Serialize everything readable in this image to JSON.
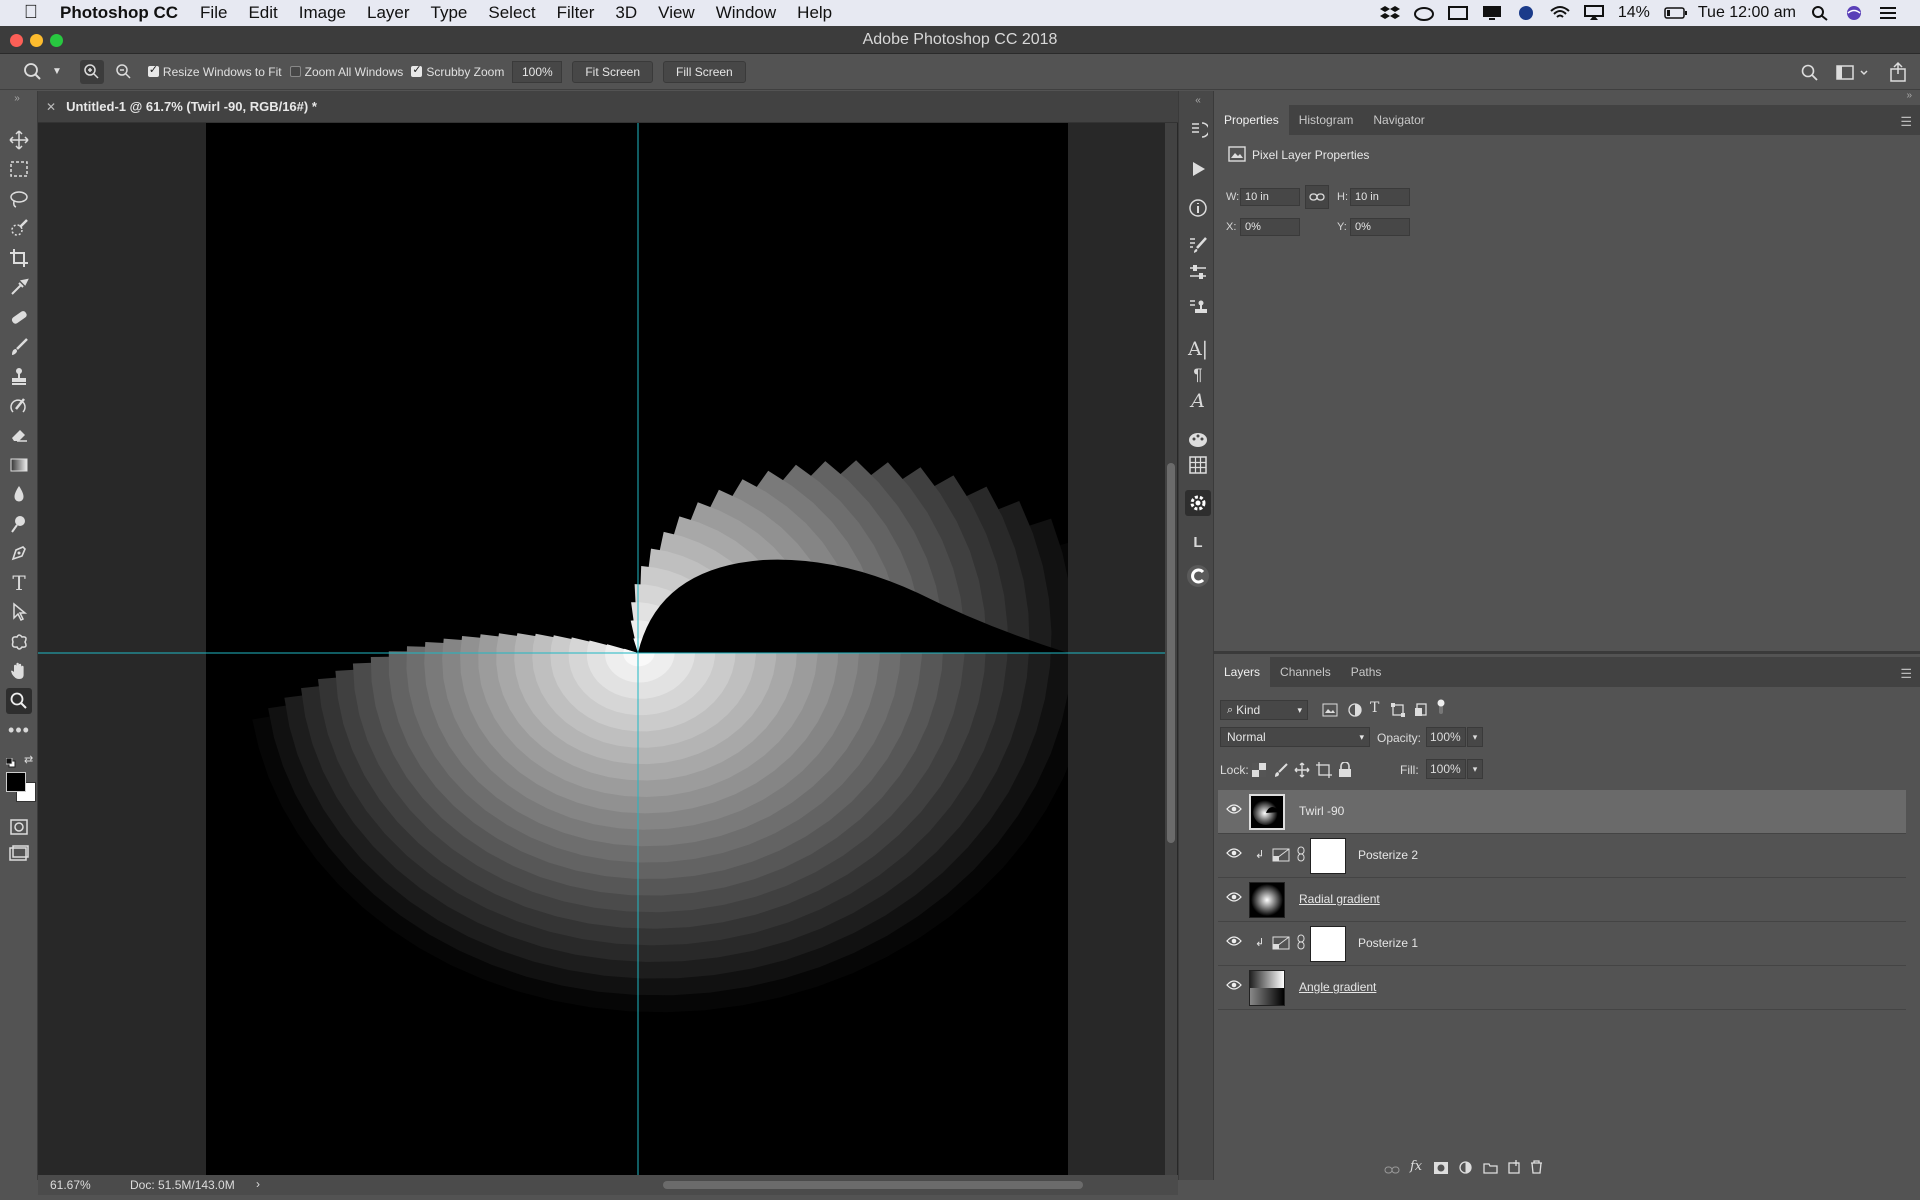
{
  "menubar": {
    "app_name": "Photoshop CC",
    "items": [
      "File",
      "Edit",
      "Image",
      "Layer",
      "Type",
      "Select",
      "Filter",
      "3D",
      "View",
      "Window",
      "Help"
    ],
    "battery": "14%",
    "clock": "Tue 12:00 am"
  },
  "window": {
    "title": "Adobe Photoshop CC 2018"
  },
  "options": {
    "resize_windows": "Resize Windows to Fit",
    "zoom_all": "Zoom All Windows",
    "scrubby_zoom": "Scrubby Zoom",
    "zoom_value": "100%",
    "fit_screen": "Fit Screen",
    "fill_screen": "Fill Screen"
  },
  "document": {
    "tab_title": "Untitled-1 @ 61.7% (Twirl -90, RGB/16#) *",
    "zoom": "61.67%",
    "doc_info": "Doc: 51.5M/143.0M"
  },
  "properties": {
    "tabs": [
      "Properties",
      "Histogram",
      "Navigator"
    ],
    "heading": "Pixel Layer Properties",
    "w_label": "W:",
    "w_value": "10 in",
    "h_label": "H:",
    "h_value": "10 in",
    "x_label": "X:",
    "x_value": "0%",
    "y_label": "Y:",
    "y_value": "0%"
  },
  "layers_panel": {
    "tabs": [
      "Layers",
      "Channels",
      "Paths"
    ],
    "filter": "Kind",
    "blend_mode": "Normal",
    "opacity_label": "Opacity:",
    "opacity_value": "100%",
    "lock_label": "Lock:",
    "fill_label": "Fill:",
    "fill_value": "100%",
    "layers": [
      {
        "name": "Twirl -90",
        "selected": true
      },
      {
        "name": "Posterize 2",
        "selected": false
      },
      {
        "name": "Radial gradient",
        "selected": false
      },
      {
        "name": "Posterize 1",
        "selected": false
      },
      {
        "name": "Angle gradient",
        "selected": false
      }
    ]
  },
  "colors": {
    "guide": "#1fb8c4",
    "canvas_bg": "#000000",
    "workspace": "#282828"
  }
}
